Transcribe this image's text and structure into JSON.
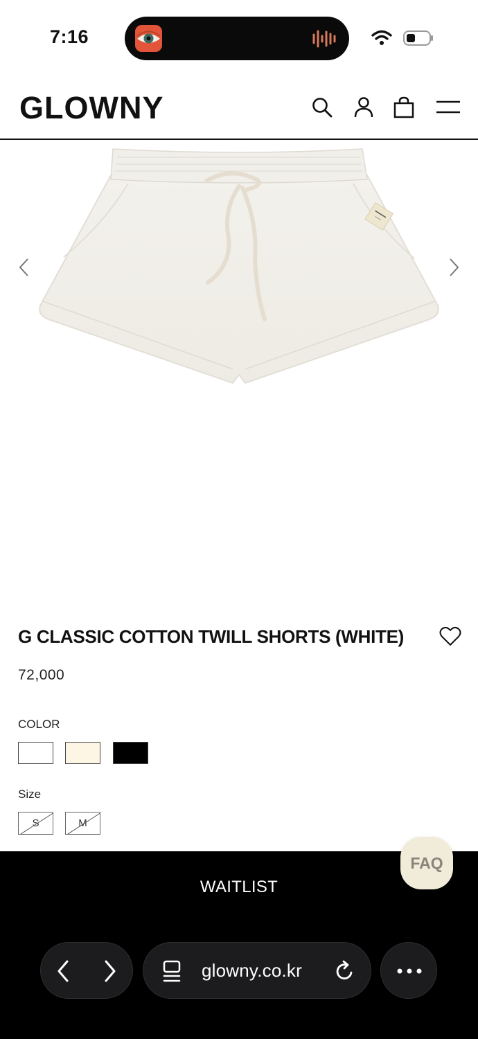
{
  "status_bar": {
    "time": "7:16",
    "icons": [
      "eye-app-icon",
      "audio-wave-icon",
      "wifi-icon",
      "battery-icon"
    ]
  },
  "header": {
    "logo": "GLOWNY",
    "icons": [
      "search-icon",
      "user-icon",
      "shopping-bag-icon",
      "menu-icon"
    ]
  },
  "gallery": {
    "prev_icon": "chevron-left-icon",
    "next_icon": "chevron-right-icon"
  },
  "product": {
    "title": "G CLASSIC COTTON TWILL SHORTS (WHITE)",
    "price": "72,000",
    "wishlist_icon": "heart-icon",
    "color_label": "COLOR",
    "colors": [
      "#ffffff",
      "#fdf6e4",
      "#000000"
    ],
    "size_label": "Size",
    "sizes": [
      "S",
      "M"
    ]
  },
  "actions": {
    "waitlist": "WAITLIST",
    "faq": "FAQ"
  },
  "browser": {
    "url": "glowny.co.kr",
    "icons": [
      "back-icon",
      "forward-icon",
      "tabs-icon",
      "reload-icon",
      "more-icon"
    ]
  },
  "colors": {
    "faq_bg": "#f1ecd9",
    "bar_bg": "#000000"
  }
}
